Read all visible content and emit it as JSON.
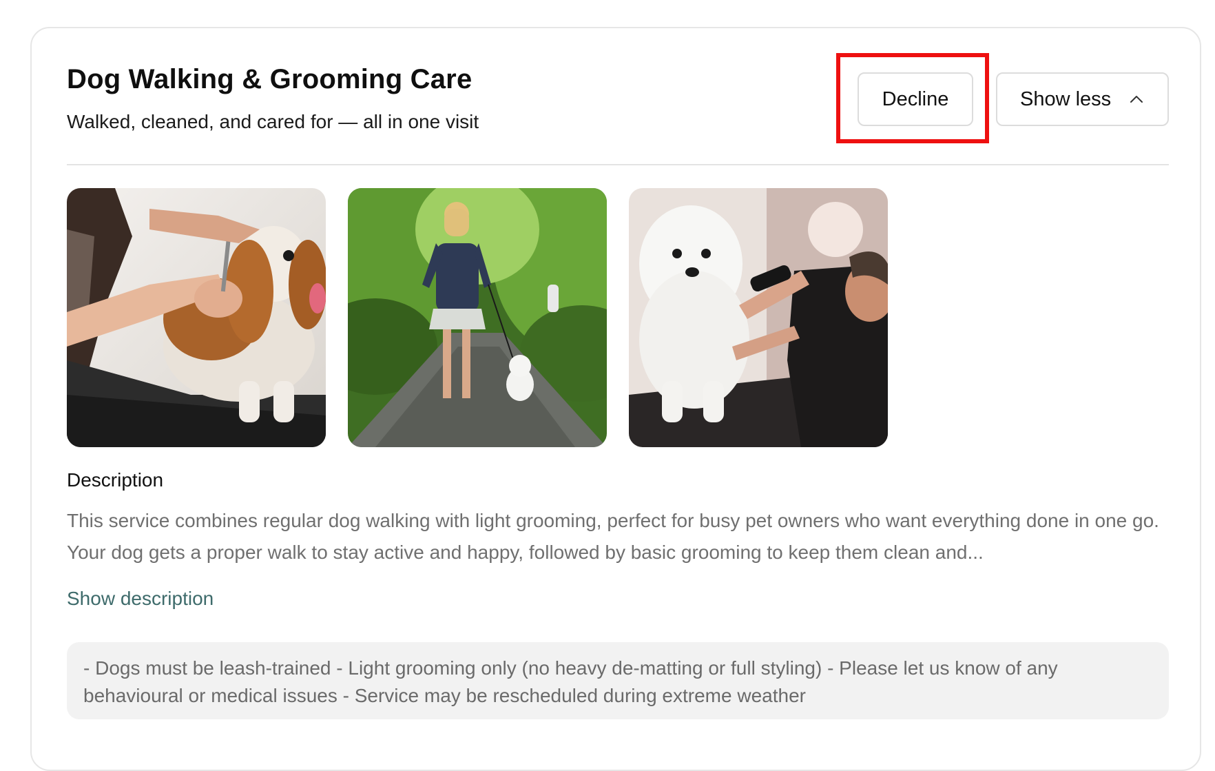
{
  "service": {
    "title": "Dog Walking & Grooming Care",
    "subtitle": "Walked, cleaned, and cared for — all in one visit"
  },
  "actions": {
    "decline_label": "Decline",
    "show_less_label": "Show less",
    "show_less_icon": "chevron-up-icon"
  },
  "annotation": {
    "highlight_color": "#ee1010"
  },
  "gallery": {
    "images": [
      {
        "name": "groomer-brushing-cavalier-spaniel"
      },
      {
        "name": "woman-walking-white-dog-in-park"
      },
      {
        "name": "groomer-clipping-white-poodle"
      }
    ]
  },
  "description": {
    "heading": "Description",
    "text": "This service combines regular dog walking with light grooming, perfect for busy pet owners who want everything done in one go. Your dog gets a proper walk to stay active and happy, followed by basic grooming to keep them clean and...",
    "toggle_label": "Show description",
    "toggle_color": "#3e6b6b"
  },
  "notes": {
    "text": "- Dogs must be leash-trained - Light grooming only (no heavy de-matting or full styling) - Please let us know of any behavioural or medical issues - Service may be rescheduled during extreme weather"
  }
}
